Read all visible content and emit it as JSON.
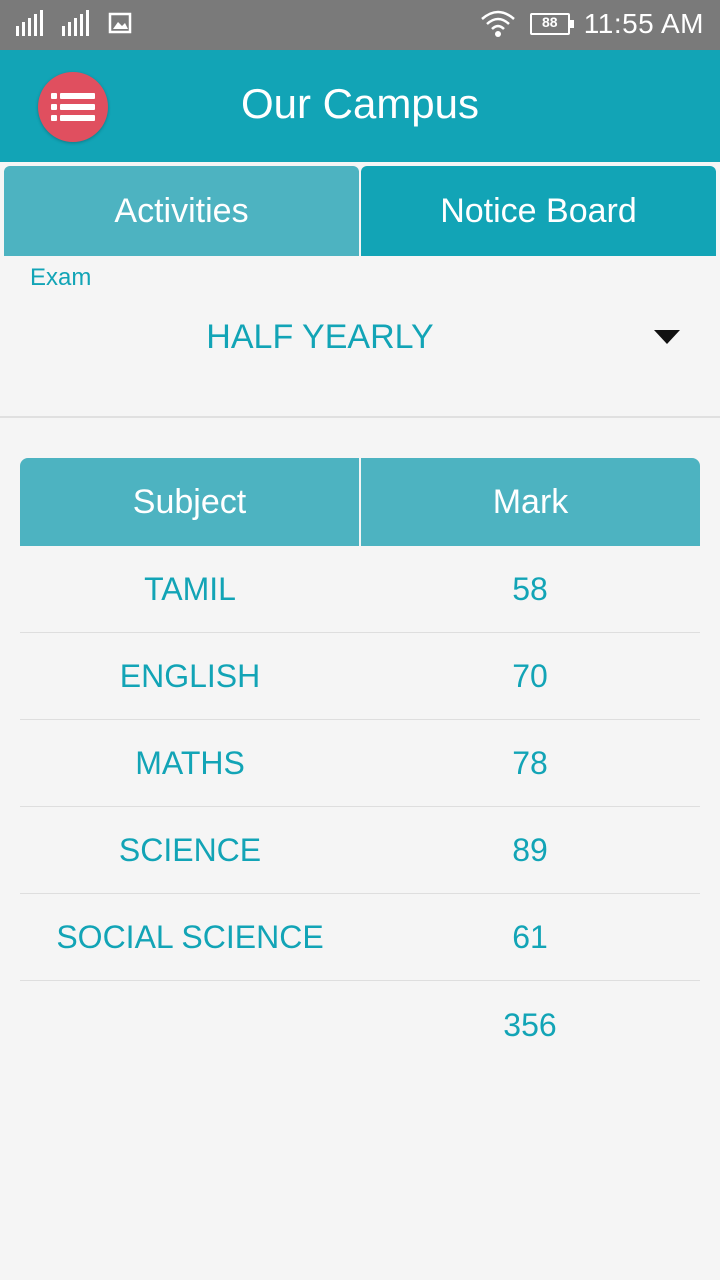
{
  "status_bar": {
    "time": "11:55 AM",
    "battery": "88",
    "icons": [
      "signal-icon",
      "signal-icon",
      "image-icon",
      "wifi-icon",
      "battery-icon"
    ]
  },
  "app_bar": {
    "title": "Our Campus",
    "menu_icon": "list-icon"
  },
  "tabs": [
    {
      "label": "Activities"
    },
    {
      "label": "Notice Board"
    }
  ],
  "exam": {
    "label": "Exam",
    "selected": "HALF YEARLY"
  },
  "marks_table": {
    "headers": [
      "Subject",
      "Mark"
    ],
    "rows": [
      {
        "subject": "TAMIL",
        "mark": "58"
      },
      {
        "subject": "ENGLISH",
        "mark": "70"
      },
      {
        "subject": "MATHS",
        "mark": "78"
      },
      {
        "subject": "SCIENCE",
        "mark": "89"
      },
      {
        "subject": "SOCIAL SCIENCE",
        "mark": "61"
      }
    ],
    "total": "356"
  },
  "colors": {
    "primary": "#12a4b6",
    "primary_light": "#4db3c1",
    "menu_button": "#e04f5f",
    "status_bar": "#7a7a7a"
  }
}
